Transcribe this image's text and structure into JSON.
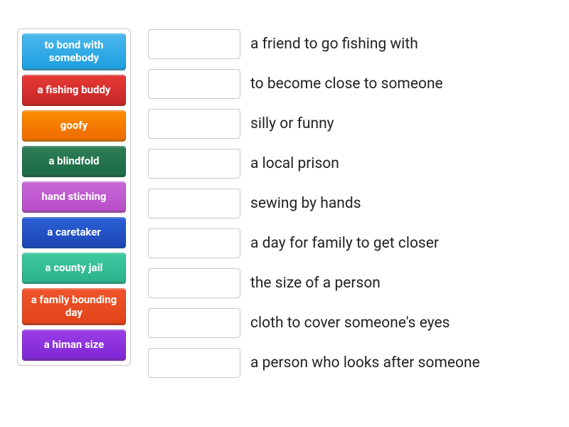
{
  "terms": [
    {
      "label": "to bond with somebody",
      "color_class": "c0"
    },
    {
      "label": "a fishing buddy",
      "color_class": "c1"
    },
    {
      "label": "goofy",
      "color_class": "c2"
    },
    {
      "label": "a blindfold",
      "color_class": "c3"
    },
    {
      "label": "hand stiching",
      "color_class": "c4"
    },
    {
      "label": "a caretaker",
      "color_class": "c5"
    },
    {
      "label": "a county jail",
      "color_class": "c6"
    },
    {
      "label": "a family bounding day",
      "color_class": "c7"
    },
    {
      "label": "a himan size",
      "color_class": "c8"
    }
  ],
  "definitions": [
    {
      "text": "a friend to go fishing with"
    },
    {
      "text": "to become close to someone"
    },
    {
      "text": "silly or funny"
    },
    {
      "text": "a local prison"
    },
    {
      "text": "sewing by hands"
    },
    {
      "text": "a day for family to get closer"
    },
    {
      "text": "the size of a person"
    },
    {
      "text": "cloth to cover someone's eyes"
    },
    {
      "text": "a person who looks after someone"
    }
  ]
}
